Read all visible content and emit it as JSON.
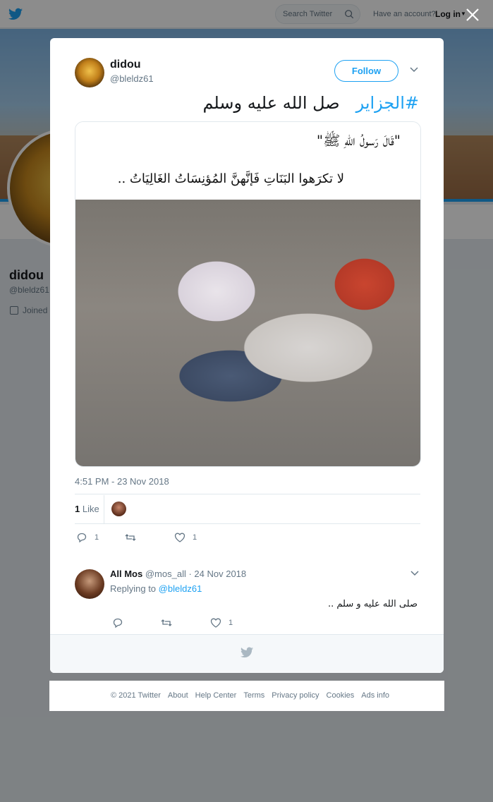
{
  "topbar": {
    "search_placeholder": "Search Twitter",
    "have_account": "Have an account?",
    "login": "Log in"
  },
  "profile": {
    "name": "didou",
    "handle": "@bleldz61",
    "joined": "Joined"
  },
  "tweet": {
    "author_name": "didou",
    "author_handle": "@bleldz61",
    "follow_label": "Follow",
    "hashtag": "#الجزاير",
    "text": "صل الله عليه وسلم",
    "media_caption_1": "\"قَالَ رَسولُ اللهِ ﷺ\"",
    "media_caption_2": "لا تكرَهوا البَنَاتِ فَإنَّهنَّ المُؤنِسَاتُ الغَالِيَاتُ ..",
    "timestamp": "4:51 PM - 23 Nov 2018",
    "likes_number": "1",
    "likes_label": "Like",
    "reply_count": "1",
    "like_count": "1"
  },
  "reply": {
    "author_name": "All Mos",
    "author_handle": "@mos_all",
    "date": "· 24 Nov 2018",
    "replying_to_label": "Replying to",
    "replying_to_handle": "@bleldz61",
    "text": "صلى الله عليه و سلم ..",
    "like_count": "1"
  },
  "footer": {
    "links": [
      "© 2021 Twitter",
      "About",
      "Help Center",
      "Terms",
      "Privacy policy",
      "Cookies",
      "Ads info"
    ]
  },
  "colors": {
    "accent": "#1da1f2",
    "text": "#14171a",
    "muted": "#657786"
  }
}
